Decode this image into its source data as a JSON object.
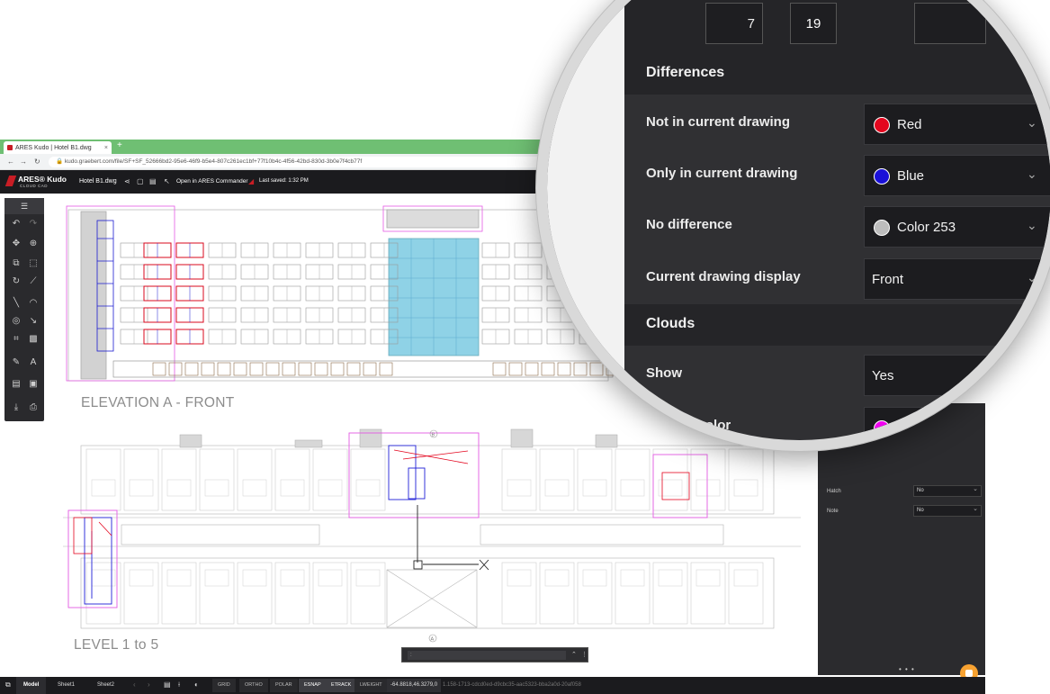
{
  "browser": {
    "tab_title": "ARES Kudo | Hotel B1.dwg",
    "tab_close": "×",
    "new_tab": "+",
    "url": "kudo.graebert.com/file/SF+SF_52666bd2-95e6-46f9-b5e4-807c261ec1bf+77f10b4c-4f56-42bd-830d-3b0e7f4cb77f"
  },
  "app": {
    "logo_text": "ARES® Kudo",
    "logo_sub": "CLOUD CAD",
    "file_name": "Hotel B1.dwg",
    "open_in": "Open in ARES Commander",
    "last_saved": "Last saved: 1:32 PM"
  },
  "drawing": {
    "elevation_label": "ELEVATION A - FRONT",
    "level_label": "LEVEL 1 to 5",
    "marker_b": "B",
    "marker_a": "A"
  },
  "magnifier": {
    "top_left_value": "7",
    "top_box_value": "19",
    "sections": {
      "differences": "Differences",
      "clouds": "Clouds"
    },
    "rows": [
      {
        "label": "Not in current drawing",
        "value": "Red",
        "swatch": "#e3061e"
      },
      {
        "label": "Only in current drawing",
        "value": "Blue",
        "swatch": "#1a10d8"
      },
      {
        "label": "No difference",
        "value": "Color 253",
        "swatch": "#bdbdbd"
      },
      {
        "label": "Current drawing display",
        "value": "Front",
        "swatch": ""
      },
      {
        "label": "Show",
        "value": "Yes",
        "swatch": ""
      },
      {
        "label": "Display color",
        "value": "Magenta",
        "swatch": "#f000f0"
      }
    ]
  },
  "panel": {
    "rows": [
      {
        "label": "Hatch",
        "value": "No"
      },
      {
        "label": "Note",
        "value": "No"
      }
    ],
    "handle": "• • •"
  },
  "cmdline": {
    "prompt": ":",
    "collapse": "⌃",
    "menu": "⋮"
  },
  "statusbar": {
    "tabs": [
      "Model",
      "Sheet1",
      "Sheet2"
    ],
    "toggles": [
      {
        "label": "GRID",
        "on": false
      },
      {
        "label": "ORTHO",
        "on": false
      },
      {
        "label": "POLAR",
        "on": false
      },
      {
        "label": "ESNAP",
        "on": true
      },
      {
        "label": "ETRACK",
        "on": true
      },
      {
        "label": "LWEIGHT",
        "on": false
      }
    ],
    "coords": "-64.8818,46.3279,0",
    "guid": "1.158-1713-cdcd0ed-d9cbc35-aac5323-bba2a0d-20af058"
  }
}
